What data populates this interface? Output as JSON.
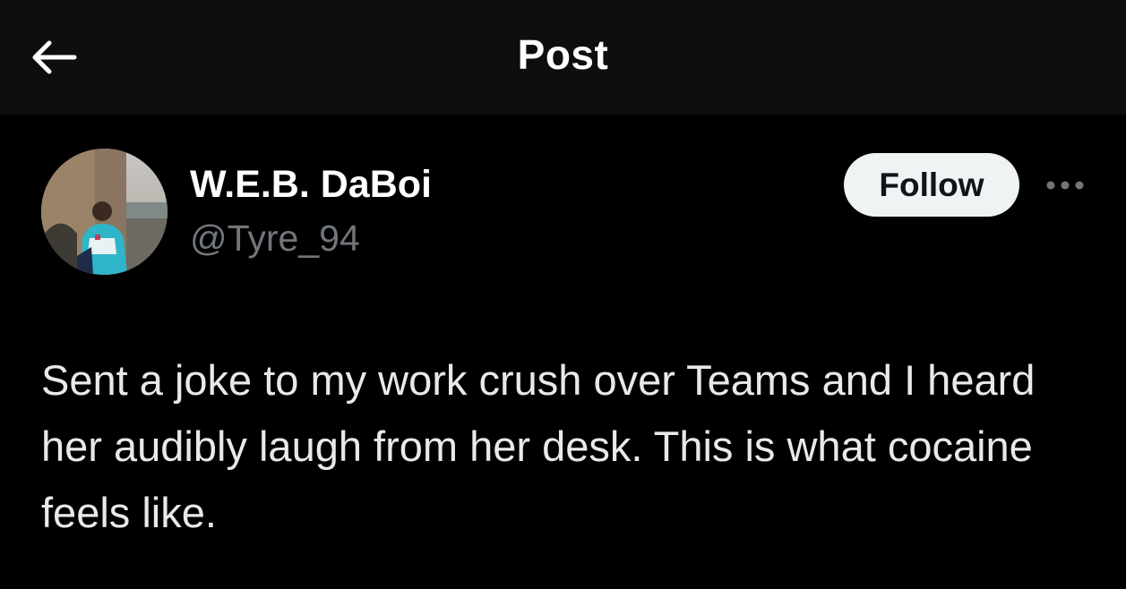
{
  "header": {
    "back_icon": "arrow-left-icon",
    "title": "Post"
  },
  "author": {
    "display_name": "W.E.B. DaBoi",
    "handle": "@Tyre_94",
    "avatar_icon": "profile-photo"
  },
  "actions": {
    "follow_label": "Follow",
    "more_icon": "more-horizontal-icon"
  },
  "post": {
    "text": "Sent a joke to my work crush over Teams and I heard her audibly laugh from her desk. This is what cocaine feels like."
  },
  "colors": {
    "background": "#000000",
    "header_background": "#0e0e0e",
    "primary_text": "#e7e9ea",
    "secondary_text": "#71767b",
    "follow_button_bg": "#eff3f4",
    "follow_button_text": "#0f1419"
  }
}
